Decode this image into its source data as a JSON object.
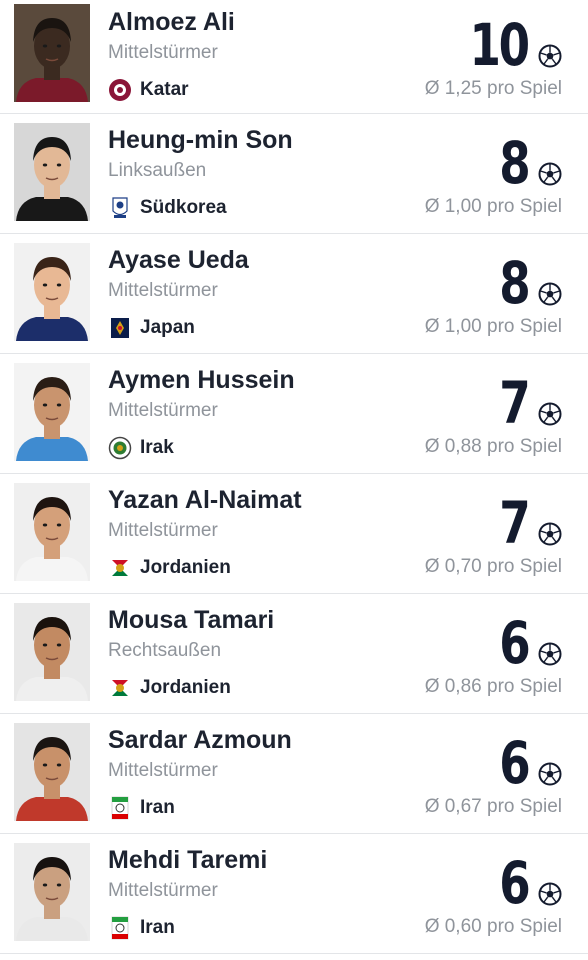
{
  "players": [
    {
      "name": "Almoez Ali",
      "position": "Mittelstürmer",
      "country": "Katar",
      "goals": "10",
      "average": "Ø 1,25 pro Spiel",
      "photo": {
        "bg": "#5a4a3c",
        "skin": "#3b2a20",
        "hair": "#1a1410",
        "shirt": "#7b1a2a"
      },
      "flag": {
        "icon": "qatar-emblem",
        "colors": [
          "#8a1538",
          "#ffffff"
        ]
      }
    },
    {
      "name": "Heung-min Son",
      "position": "Linksaußen",
      "country": "Südkorea",
      "goals": "8",
      "average": "Ø 1,00 pro Spiel",
      "photo": {
        "bg": "#d7d7d7",
        "skin": "#e2b896",
        "hair": "#161616",
        "shirt": "#181818"
      },
      "flag": {
        "icon": "korea-emblem",
        "colors": [
          "#1d3f86",
          "#ffffff"
        ]
      }
    },
    {
      "name": "Ayase Ueda",
      "position": "Mittelstürmer",
      "country": "Japan",
      "goals": "8",
      "average": "Ø 1,00 pro Spiel",
      "photo": {
        "bg": "#f1f1f1",
        "skin": "#e8b894",
        "hair": "#3a2418",
        "shirt": "#1c2e6a"
      },
      "flag": {
        "icon": "japan-emblem",
        "colors": [
          "#0b1d4a",
          "#d4a017"
        ]
      }
    },
    {
      "name": "Aymen Hussein",
      "position": "Mittelstürmer",
      "country": "Irak",
      "goals": "7",
      "average": "Ø 0,88 pro Spiel",
      "photo": {
        "bg": "#f3f3f3",
        "skin": "#c9946e",
        "hair": "#2a1d15",
        "shirt": "#3f8bd0"
      },
      "flag": {
        "icon": "iraq-emblem",
        "colors": [
          "#ffffff",
          "#2e7d32"
        ]
      }
    },
    {
      "name": "Yazan Al-Naimat",
      "position": "Mittelstürmer",
      "country": "Jordanien",
      "goals": "7",
      "average": "Ø 0,70 pro Spiel",
      "photo": {
        "bg": "#efefef",
        "skin": "#d4a07a",
        "hair": "#1e1410",
        "shirt": "#f5f5f5"
      },
      "flag": {
        "icon": "jordan-emblem",
        "colors": [
          "#ce1126",
          "#007a3d"
        ]
      }
    },
    {
      "name": "Mousa Tamari",
      "position": "Rechtsaußen",
      "country": "Jordanien",
      "goals": "6",
      "average": "Ø 0,86 pro Spiel",
      "photo": {
        "bg": "#e9e9e9",
        "skin": "#c28a62",
        "hair": "#1a120d",
        "shirt": "#efefef"
      },
      "flag": {
        "icon": "jordan-emblem",
        "colors": [
          "#ce1126",
          "#007a3d"
        ]
      }
    },
    {
      "name": "Sardar Azmoun",
      "position": "Mittelstürmer",
      "country": "Iran",
      "goals": "6",
      "average": "Ø 0,67 pro Spiel",
      "photo": {
        "bg": "#e4e4e4",
        "skin": "#c8916a",
        "hair": "#1b1512",
        "shirt": "#c0392b"
      },
      "flag": {
        "icon": "iran-emblem",
        "colors": [
          "#239f40",
          "#da0000"
        ]
      }
    },
    {
      "name": "Mehdi Taremi",
      "position": "Mittelstürmer",
      "country": "Iran",
      "goals": "6",
      "average": "Ø 0,60 pro Spiel",
      "photo": {
        "bg": "#ececec",
        "skin": "#caa080",
        "hair": "#171210",
        "shirt": "#e9e9e9"
      },
      "flag": {
        "icon": "iran-emblem",
        "colors": [
          "#239f40",
          "#da0000"
        ]
      }
    }
  ],
  "icons": {
    "goal": "football-icon"
  }
}
